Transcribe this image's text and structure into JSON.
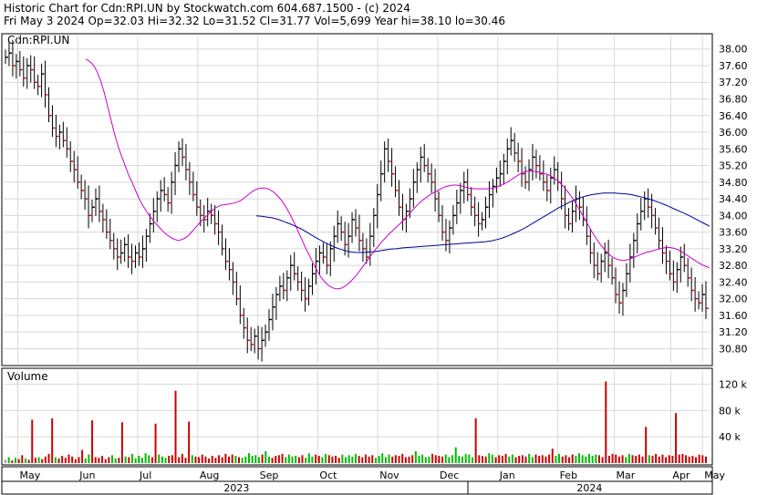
{
  "header": {
    "line1": "Historic Chart for Cdn:RPI.UN by Stockwatch.com 604.687.1500 - (c) 2024",
    "line2": "Fri May  3 2024  Op=32.03  Hi=32.32  Lo=31.52  Cl=31.77  Vol=5,699  Year hi=38.10  lo=30.46"
  },
  "chart_data": {
    "type": "ohlc",
    "symbol_label": "Cdn:RPI.UN",
    "price_axis": {
      "ylim": [
        30.46,
        38.3
      ],
      "ticks": [
        "38.00",
        "37.60",
        "37.20",
        "36.80",
        "36.40",
        "36.00",
        "35.60",
        "35.20",
        "34.80",
        "34.40",
        "34.00",
        "33.60",
        "33.20",
        "32.80",
        "32.40",
        "32.00",
        "31.60",
        "31.20",
        "30.80"
      ]
    },
    "volume_panel": {
      "label": "Volume",
      "ylim": [
        0,
        140
      ],
      "ticks": [
        "120 k",
        "80 k",
        "40 k"
      ],
      "units": "thousands"
    },
    "x_axis": {
      "months": [
        "May",
        "Jun",
        "Jul",
        "Aug",
        "Sep",
        "Oct",
        "Nov",
        "Dec",
        "Jan",
        "Feb",
        "Mar",
        "Apr",
        "May"
      ],
      "years": [
        "2023",
        "2024"
      ]
    },
    "series": {
      "close": [
        37.8,
        37.9,
        37.6,
        37.7,
        37.5,
        37.3,
        37.6,
        37.5,
        37.2,
        37.1,
        37.4,
        36.9,
        36.4,
        36.1,
        35.9,
        36.0,
        35.8,
        35.6,
        35.3,
        35.1,
        34.8,
        34.6,
        34.4,
        34.0,
        34.2,
        34.4,
        34.1,
        33.9,
        33.6,
        33.4,
        33.2,
        33.0,
        33.1,
        33.3,
        33.0,
        32.9,
        33.1,
        33.0,
        33.2,
        33.5,
        33.8,
        34.1,
        34.4,
        34.6,
        34.5,
        34.3,
        34.8,
        35.2,
        35.6,
        35.4,
        35.1,
        34.8,
        34.5,
        34.2,
        34.0,
        33.9,
        34.1,
        34.0,
        33.8,
        33.6,
        33.2,
        32.9,
        32.7,
        32.4,
        32.0,
        31.6,
        31.3,
        31.0,
        30.9,
        31.1,
        30.8,
        31.0,
        31.2,
        31.5,
        31.8,
        32.1,
        32.3,
        32.2,
        32.5,
        32.8,
        32.6,
        32.4,
        32.2,
        32.0,
        32.3,
        32.6,
        32.9,
        33.1,
        33.0,
        32.8,
        33.2,
        33.5,
        33.8,
        33.6,
        33.3,
        33.5,
        33.9,
        33.7,
        33.4,
        33.2,
        33.0,
        33.5,
        34.0,
        34.5,
        35.0,
        35.6,
        35.3,
        35.0,
        34.6,
        34.2,
        33.9,
        34.1,
        34.4,
        34.8,
        35.1,
        35.4,
        35.2,
        35.0,
        34.8,
        34.4,
        34.0,
        33.6,
        33.4,
        33.7,
        34.0,
        34.3,
        34.6,
        34.8,
        34.5,
        34.2,
        34.0,
        33.8,
        33.9,
        34.2,
        34.5,
        34.7,
        34.9,
        35.0,
        35.3,
        35.6,
        35.8,
        35.5,
        35.3,
        35.0,
        34.8,
        35.1,
        35.4,
        35.2,
        35.0,
        34.8,
        34.6,
        34.9,
        35.1,
        34.8,
        34.4,
        34.0,
        33.8,
        34.1,
        34.4,
        34.2,
        33.9,
        33.5,
        33.1,
        32.8,
        32.6,
        32.9,
        33.1,
        32.8,
        32.5,
        32.1,
        31.9,
        32.2,
        32.6,
        33.0,
        33.4,
        33.8,
        34.1,
        34.4,
        34.2,
        34.0,
        33.7,
        33.4,
        33.1,
        32.9,
        32.6,
        32.4,
        32.7,
        33.0,
        32.8,
        32.5,
        32.2,
        32.0,
        31.9,
        32.1,
        31.77
      ],
      "ma_short": [
        37.75,
        37.72,
        37.65,
        37.55,
        37.4,
        37.2,
        36.95,
        36.65,
        36.35,
        36.05,
        35.78,
        35.55,
        35.35,
        35.15,
        34.95,
        34.8,
        34.62,
        34.45,
        34.3,
        34.18,
        34.06,
        33.96,
        33.86,
        33.78,
        33.7,
        33.62,
        33.55,
        33.5,
        33.45,
        33.42,
        33.4,
        33.42,
        33.45,
        33.5,
        33.58,
        33.66,
        33.75,
        33.83,
        33.91,
        33.98,
        34.05,
        34.12,
        34.18,
        34.22,
        34.25,
        34.26,
        34.27,
        34.28,
        34.3,
        34.32,
        34.35,
        34.4,
        34.46,
        34.52,
        34.58,
        34.62,
        34.65,
        34.66,
        34.66,
        34.64,
        34.6,
        34.55,
        34.48,
        34.4,
        34.3,
        34.18,
        34.05,
        33.9,
        33.75,
        33.58,
        33.42,
        33.25,
        33.1,
        32.95,
        32.8,
        32.66,
        32.54,
        32.44,
        32.36,
        32.3,
        32.26,
        32.24,
        32.24,
        32.26,
        32.3,
        32.36,
        32.43,
        32.51,
        32.6,
        32.7,
        32.8,
        32.9,
        33.0,
        33.1,
        33.2,
        33.29,
        33.38,
        33.46,
        33.54,
        33.61,
        33.68,
        33.75,
        33.82,
        33.9,
        33.98,
        34.06,
        34.14,
        34.22,
        34.3,
        34.36,
        34.42,
        34.47,
        34.52,
        34.56,
        34.6,
        34.64,
        34.68,
        34.7,
        34.72,
        34.73,
        34.73,
        34.72,
        34.7,
        34.68,
        34.66,
        34.65,
        34.64,
        34.64,
        34.64,
        34.64,
        34.64,
        34.65,
        34.66,
        34.68,
        34.71,
        34.74,
        34.78,
        34.82,
        34.87,
        34.92,
        34.97,
        35.01,
        35.04,
        35.06,
        35.06,
        35.06,
        35.05,
        35.04,
        35.02,
        35.0,
        34.97,
        34.93,
        34.88,
        34.82,
        34.75,
        34.67,
        34.58,
        34.48,
        34.37,
        34.25,
        34.12,
        33.99,
        33.86,
        33.73,
        33.6,
        33.48,
        33.37,
        33.27,
        33.18,
        33.1,
        33.03,
        32.98,
        32.95,
        32.93,
        32.92,
        32.93,
        32.95,
        32.98,
        33.01,
        33.04,
        33.07,
        33.1,
        33.12,
        33.14,
        33.16,
        33.18,
        33.2,
        33.22,
        33.23,
        33.23,
        33.22,
        33.2,
        33.17,
        33.13,
        33.08,
        33.03,
        32.98,
        32.93,
        32.88,
        32.84,
        32.8,
        32.77,
        32.74
      ],
      "ma_long": [
        33.99,
        33.98,
        33.96,
        33.94,
        33.9,
        33.85,
        33.8,
        33.74,
        33.68,
        33.6,
        33.52,
        33.44,
        33.37,
        33.3,
        33.24,
        33.19,
        33.15,
        33.12,
        33.11,
        33.11,
        33.12,
        33.13,
        33.15,
        33.17,
        33.19,
        33.2,
        33.22,
        33.23,
        33.24,
        33.25,
        33.26,
        33.27,
        33.28,
        33.29,
        33.3,
        33.31,
        33.32,
        33.33,
        33.34,
        33.35,
        33.36,
        33.37,
        33.39,
        33.42,
        33.46,
        33.51,
        33.57,
        33.63,
        33.7,
        33.78,
        33.86,
        33.94,
        34.02,
        34.1,
        34.18,
        34.25,
        34.32,
        34.38,
        34.43,
        34.47,
        34.5,
        34.52,
        34.54,
        34.54,
        34.54,
        34.53,
        34.52,
        34.5,
        34.47,
        34.44,
        34.4,
        34.36,
        34.31,
        34.26,
        34.2,
        34.14,
        34.08,
        34.02,
        33.95,
        33.88,
        33.81,
        33.74
      ]
    },
    "volume": [
      5,
      9,
      4,
      8,
      6,
      12,
      7,
      5,
      66,
      8,
      9,
      6,
      10,
      14,
      68,
      9,
      7,
      11,
      8,
      13,
      10,
      6,
      9,
      20,
      7,
      13,
      65,
      9,
      8,
      11,
      6,
      9,
      12,
      7,
      8,
      62,
      10,
      9,
      14,
      7,
      11,
      8,
      15,
      12,
      9,
      60,
      13,
      10,
      8,
      11,
      12,
      110,
      9,
      14,
      8,
      63,
      12,
      10,
      9,
      13,
      10,
      7,
      11,
      8,
      12,
      9,
      14,
      10,
      13,
      11,
      9,
      8,
      10,
      15,
      11,
      12,
      9,
      13,
      18,
      10,
      8,
      11,
      12,
      14,
      9,
      13,
      10,
      11,
      9,
      12,
      8,
      15,
      10,
      13,
      11,
      9,
      14,
      12,
      10,
      11,
      8,
      13,
      9,
      12,
      10,
      14,
      11,
      9,
      13,
      10,
      12,
      8,
      11,
      15,
      9,
      13,
      10,
      12,
      11,
      14,
      9,
      10,
      12,
      18,
      11,
      13,
      9,
      10,
      14,
      12,
      11,
      10,
      13,
      9,
      12,
      24,
      11,
      10,
      14,
      13,
      9,
      68,
      12,
      11,
      10,
      15,
      13,
      9,
      12,
      11,
      14,
      10,
      13,
      9,
      11,
      12,
      10,
      14,
      9,
      13,
      11,
      12,
      10,
      13,
      22,
      11,
      14,
      10,
      12,
      9,
      13,
      11,
      15,
      12,
      10,
      14,
      11,
      13,
      12,
      9,
      124,
      11,
      14,
      13,
      10,
      12,
      9,
      14,
      12,
      11,
      13,
      10,
      55,
      12,
      11,
      14,
      10,
      13,
      9,
      12,
      11,
      76,
      13,
      14,
      12,
      10,
      11,
      9,
      13,
      12,
      10
    ],
    "volume_colors": {
      "up": "#00bb00",
      "down": "#cc0000",
      "flat": "#999999"
    },
    "colors": {
      "bar_up": "#000000",
      "bar_down": "#cc0000",
      "ma_short": "#cc00cc",
      "ma_long": "#000099",
      "grid": "#d8d8d8"
    }
  }
}
